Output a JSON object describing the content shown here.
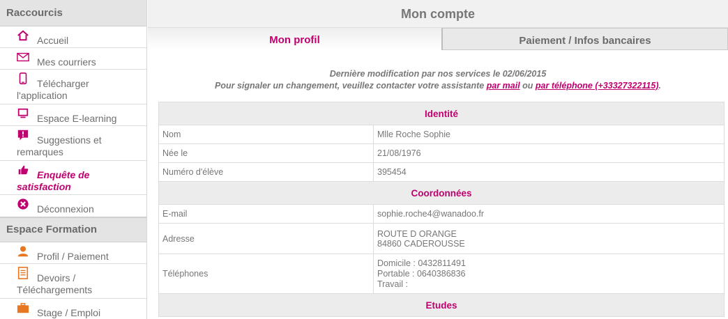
{
  "sidebar": {
    "header1": "Raccourcis",
    "header2": "Espace Formation",
    "items": [
      {
        "label": "Accueil",
        "icon": "home-icon"
      },
      {
        "label": "Mes courriers",
        "icon": "mail-icon"
      },
      {
        "label": "Télécharger l'application",
        "icon": "phone-icon"
      },
      {
        "label": "Espace E-learning",
        "icon": "monitor-icon"
      },
      {
        "label": "Suggestions et remarques",
        "icon": "comment-alert-icon"
      },
      {
        "label": "Enquête de satisfaction",
        "icon": "thumbs-up-icon"
      },
      {
        "label": "Déconnexion",
        "icon": "logout-x-icon"
      }
    ],
    "formation_items": [
      {
        "label": "Profil / Paiement",
        "icon": "user-icon"
      },
      {
        "label": "Devoirs / Téléchargements",
        "icon": "document-icon"
      },
      {
        "label": "Stage / Emploi",
        "icon": "briefcase-icon"
      }
    ]
  },
  "main": {
    "title": "Mon compte",
    "tabs": [
      "Mon profil",
      "Paiement / Infos bancaires"
    ],
    "notice_line1": "Dernière modification par nos services le 02/06/2015",
    "notice_line2_prefix": "Pour signaler un changement, veuillez contacter votre assistante ",
    "notice_link_mail": "par mail",
    "notice_or": " ou ",
    "notice_link_phone": "par téléphone (+33327322115)",
    "notice_suffix": "."
  },
  "profile": {
    "identite_title": "Identité",
    "nom_label": "Nom",
    "nom_value": "Mlle Roche Sophie",
    "nee_label": "Née le",
    "nee_value": "21/08/1976",
    "numero_label": "Numéro d'élève",
    "numero_value": "395454",
    "coordonnees_title": "Coordonnées",
    "email_label": "E-mail",
    "email_value": "sophie.roche4@wanadoo.fr",
    "adresse_label": "Adresse",
    "adresse_line1": "ROUTE D ORANGE",
    "adresse_line2": "84860 CADEROUSSE",
    "telephones_label": "Téléphones",
    "tel_domicile": "Domicile : 0432811491",
    "tel_portable": "Portable : 0640386836",
    "tel_travail": "Travail :",
    "etudes_title": "Etudes"
  },
  "colors": {
    "accent": "#c0006e",
    "header_bg": "#e4e4e4",
    "text": "#777777"
  }
}
